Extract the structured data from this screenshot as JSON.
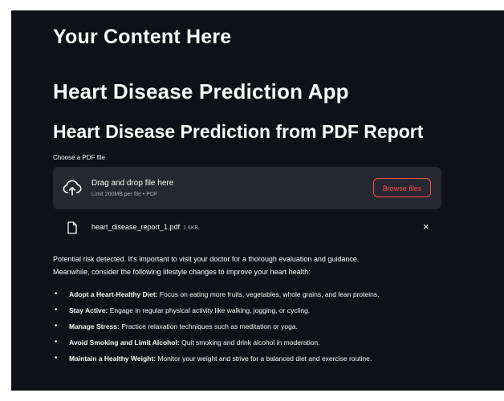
{
  "headings": {
    "placeholder": "Your Content Here",
    "app_title": "Heart Disease Prediction App",
    "section_title": "Heart Disease Prediction from PDF Report"
  },
  "uploader": {
    "label": "Choose a PDF file",
    "drop_title": "Drag and drop file here",
    "drop_subtitle": "Limit 200MB per file • PDF",
    "browse_label": "Browse files",
    "file": {
      "name": "heart_disease_report_1.pdf",
      "size": "1.6KB",
      "remove": "×"
    }
  },
  "result": {
    "message_line1": "Potential risk detected. It's important to visit your doctor for a thorough evaluation and guidance.",
    "message_line2": "Meanwhile, consider the following lifestyle changes to improve your heart health:",
    "tips": [
      {
        "title": "Adopt a Heart-Healthy Diet:",
        "text": " Focus on eating more fruits, vegetables, whole grains, and lean proteins."
      },
      {
        "title": "Stay Active:",
        "text": " Engage in regular physical activity like walking, jogging, or cycling."
      },
      {
        "title": "Manage Stress:",
        "text": " Practice relaxation techniques such as meditation or yoga."
      },
      {
        "title": "Avoid Smoking and Limit Alcohol:",
        "text": " Quit smoking and drink alcohol in moderation."
      },
      {
        "title": "Maintain a Healthy Weight:",
        "text": " Monitor your weight and strive for a balanced diet and exercise routine."
      }
    ]
  },
  "colors": {
    "background": "#0e1117",
    "dropzone": "#262730",
    "accent": "#ff4b4b",
    "text": "#fafafa",
    "muted": "#a3a8b8"
  },
  "icons": {
    "upload": "cloud-upload-icon",
    "file": "file-icon",
    "close": "close-icon"
  }
}
